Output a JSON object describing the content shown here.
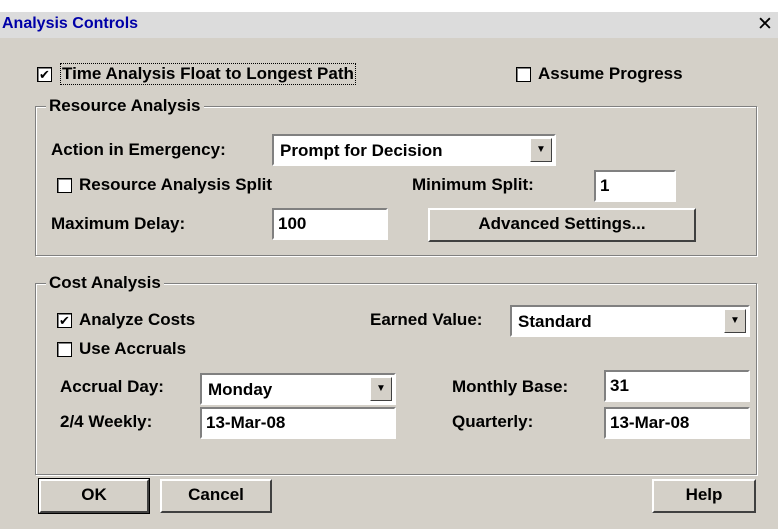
{
  "window": {
    "title": "Analysis Controls",
    "close_glyph": "✕"
  },
  "options": {
    "time_analysis_float": {
      "label": "Time Analysis Float to Longest Path",
      "checked": true
    },
    "assume_progress": {
      "label": "Assume Progress",
      "checked": false
    }
  },
  "resource_analysis": {
    "legend": "Resource Analysis",
    "action_label": "Action in Emergency:",
    "action_value": "Prompt for Decision",
    "split": {
      "label": "Resource Analysis Split",
      "checked": false
    },
    "minimum_split_label": "Minimum Split:",
    "minimum_split_value": "1",
    "maximum_delay_label": "Maximum Delay:",
    "maximum_delay_value": "100",
    "advanced_button": "Advanced Settings..."
  },
  "cost_analysis": {
    "legend": "Cost Analysis",
    "analyze_costs": {
      "label": "Analyze Costs",
      "checked": true
    },
    "use_accruals": {
      "label": "Use Accruals",
      "checked": false
    },
    "earned_value_label": "Earned Value:",
    "earned_value_value": "Standard",
    "accrual_day_label": "Accrual Day:",
    "accrual_day_value": "Monday",
    "monthly_base_label": "Monthly Base:",
    "monthly_base_value": "31",
    "weekly_label": "2/4 Weekly:",
    "weekly_value": "13-Mar-08",
    "quarterly_label": "Quarterly:",
    "quarterly_value": "13-Mar-08"
  },
  "buttons": {
    "ok": "OK",
    "cancel": "Cancel",
    "help": "Help"
  },
  "icons": {
    "check": "✔",
    "dropdown_arrow": "▼"
  }
}
